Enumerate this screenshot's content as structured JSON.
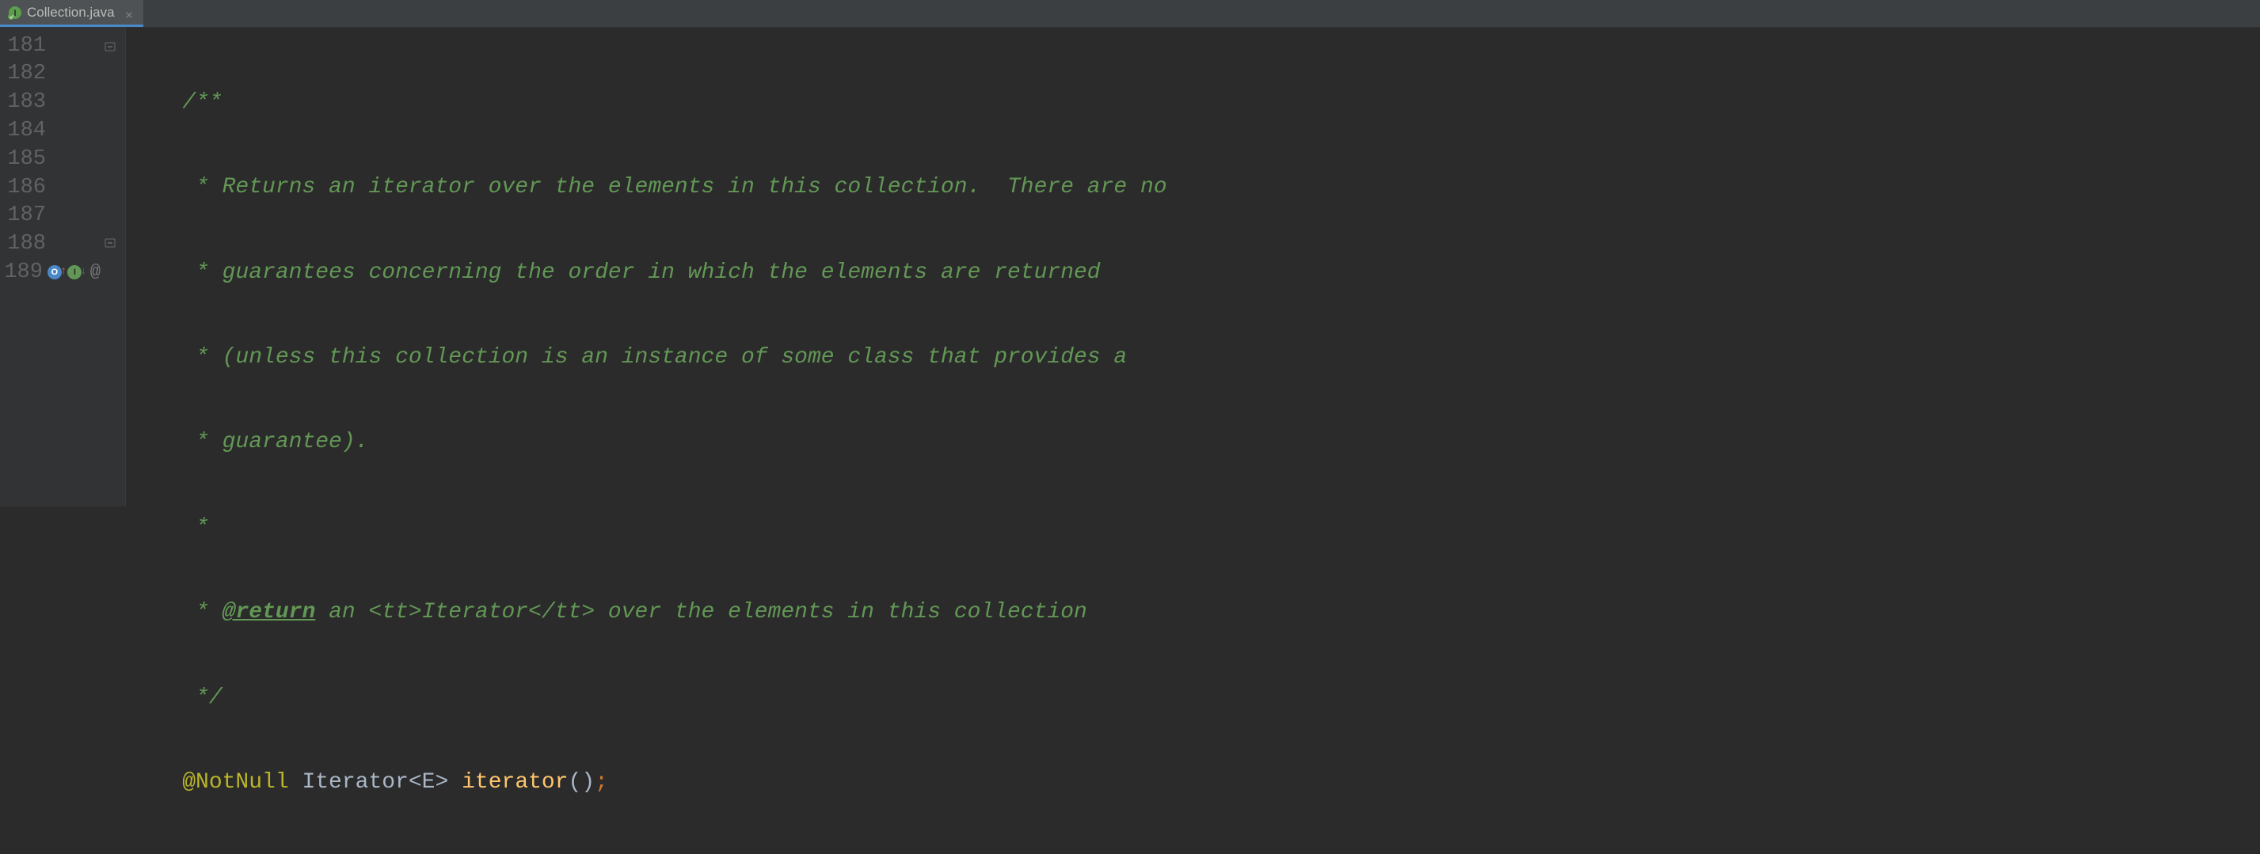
{
  "tab": {
    "filename": "Collection.java",
    "icon_name": "java-interface-icon"
  },
  "gutter": {
    "lines": [
      "181",
      "182",
      "183",
      "184",
      "185",
      "186",
      "187",
      "188",
      "189"
    ]
  },
  "code": {
    "line181": {
      "prefix": "    ",
      "t": "/**"
    },
    "line182": {
      "prefix": "     ",
      "star": "*",
      "t": " Returns an iterator over the elements in this collection.  There are no"
    },
    "line183": {
      "prefix": "     ",
      "star": "*",
      "t": " guarantees concerning the order in which the elements are returned"
    },
    "line184": {
      "prefix": "     ",
      "star": "*",
      "t": " (unless this collection is an instance of some class that provides a"
    },
    "line185": {
      "prefix": "     ",
      "star": "*",
      "t": " guarantee)."
    },
    "line186": {
      "prefix": "     ",
      "star": "*",
      "t": ""
    },
    "line187": {
      "prefix": "     ",
      "star": "*",
      "tag": "@return",
      "t": " an <tt>Iterator</tt> over the elements in this collection"
    },
    "line188": {
      "prefix": "     ",
      "t": "*/"
    },
    "line189": {
      "prefix": "    ",
      "annotation": "@NotNull",
      "space1": " ",
      "type": "Iterator<E>",
      "space2": " ",
      "method": "iterator",
      "parens": "()",
      "semi": ";"
    }
  }
}
